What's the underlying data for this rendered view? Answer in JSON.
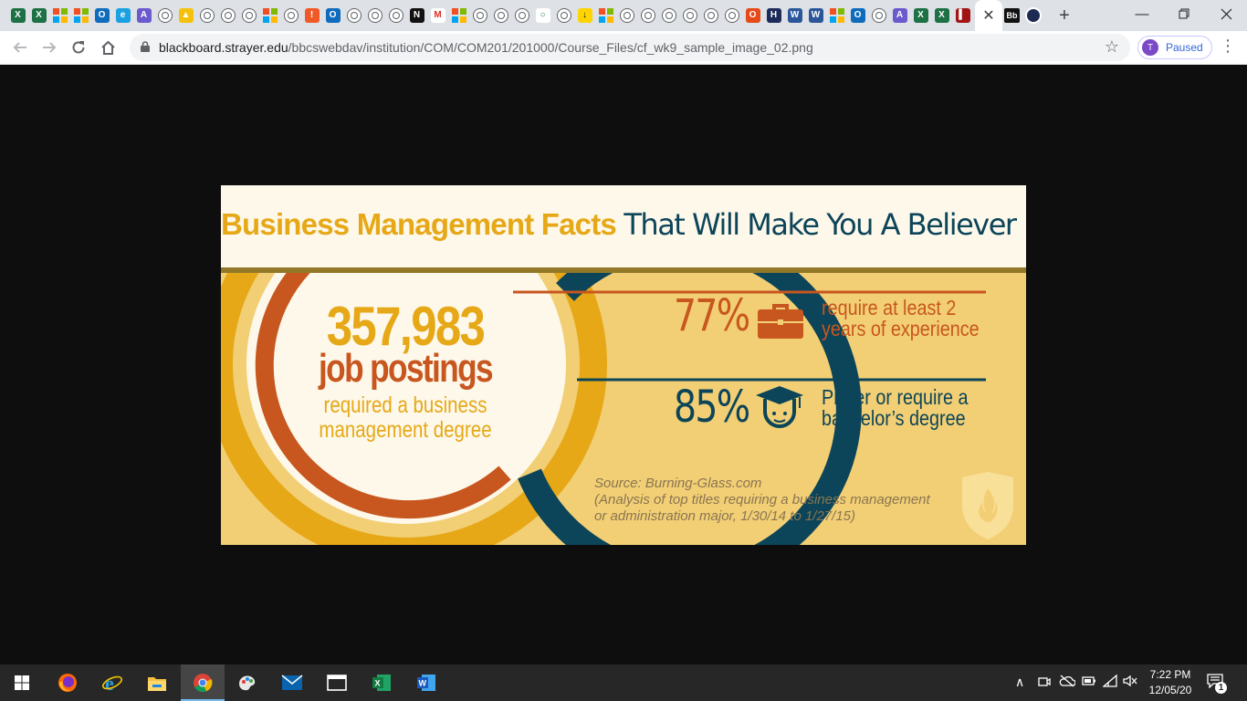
{
  "browser": {
    "tab_favicons": [
      "excel-icon",
      "excel-icon",
      "ms-icon",
      "ms-icon",
      "outlook-icon",
      "edge-icon",
      "acrobat-icon",
      "globe-icon",
      "drive-icon",
      "globe-icon",
      "globe-icon",
      "globe-icon",
      "ms-icon",
      "globe-icon",
      "alert-icon",
      "outlook-icon",
      "globe-icon",
      "globe-icon",
      "globe-icon",
      "notion-icon",
      "gmail-icon",
      "ms-icon",
      "globe-icon",
      "globe-icon",
      "globe-icon",
      "chat-icon",
      "globe-icon",
      "download-icon",
      "ms-icon",
      "globe-icon",
      "globe-icon",
      "globe-icon",
      "globe-icon",
      "globe-icon",
      "globe-icon",
      "office-icon",
      "hub-icon",
      "word-icon",
      "word-icon",
      "ms-icon",
      "outlook-icon",
      "globe-icon",
      "acrobat-icon",
      "excel-icon",
      "excel-icon",
      "book-icon",
      "blackboard-icon"
    ],
    "active_tab_close": "✕",
    "next_tab_label": "Bb",
    "new_tab": "+",
    "url_host": "blackboard.strayer.edu",
    "url_path": "/bbcswebdav/institution/COM/COM201/201000/Course_Files/cf_wk9_sample_image_02.png",
    "profile_initial": "T",
    "profile_status": "Paused"
  },
  "infographic": {
    "title_highlight": "Business Management Facts",
    "title_rest": "That Will Make You A Believer",
    "big_number": "357,983",
    "big_label": "job postings",
    "big_caption_1": "required a business",
    "big_caption_2": "management degree",
    "stat1_percent": "77%",
    "stat1_text_1": "require at least 2",
    "stat1_text_2": "years of experience",
    "stat2_percent": "85%",
    "stat2_text_1": "Prefer or require a",
    "stat2_text_2": "bachelor’s degree",
    "source_1": "Source: Burning-Glass.com",
    "source_2": "(Analysis of top titles requiring a business management",
    "source_3": "or administration major, 1/30/14 to 1/27/15)",
    "colors": {
      "gold": "#e6a817",
      "rust": "#c8561f",
      "navy": "#0c4459",
      "cream": "#fdf8ea",
      "panel": "#f2cf74"
    }
  },
  "taskbar": {
    "clock_time": "7:22 PM",
    "clock_date": "12/05/20",
    "notification_count": "1",
    "apps": [
      "start-icon",
      "firefox-icon",
      "ie-icon",
      "file-explorer-icon",
      "chrome-icon",
      "paint-icon",
      "mail-icon",
      "window-icon",
      "excel-icon",
      "word-icon"
    ]
  }
}
